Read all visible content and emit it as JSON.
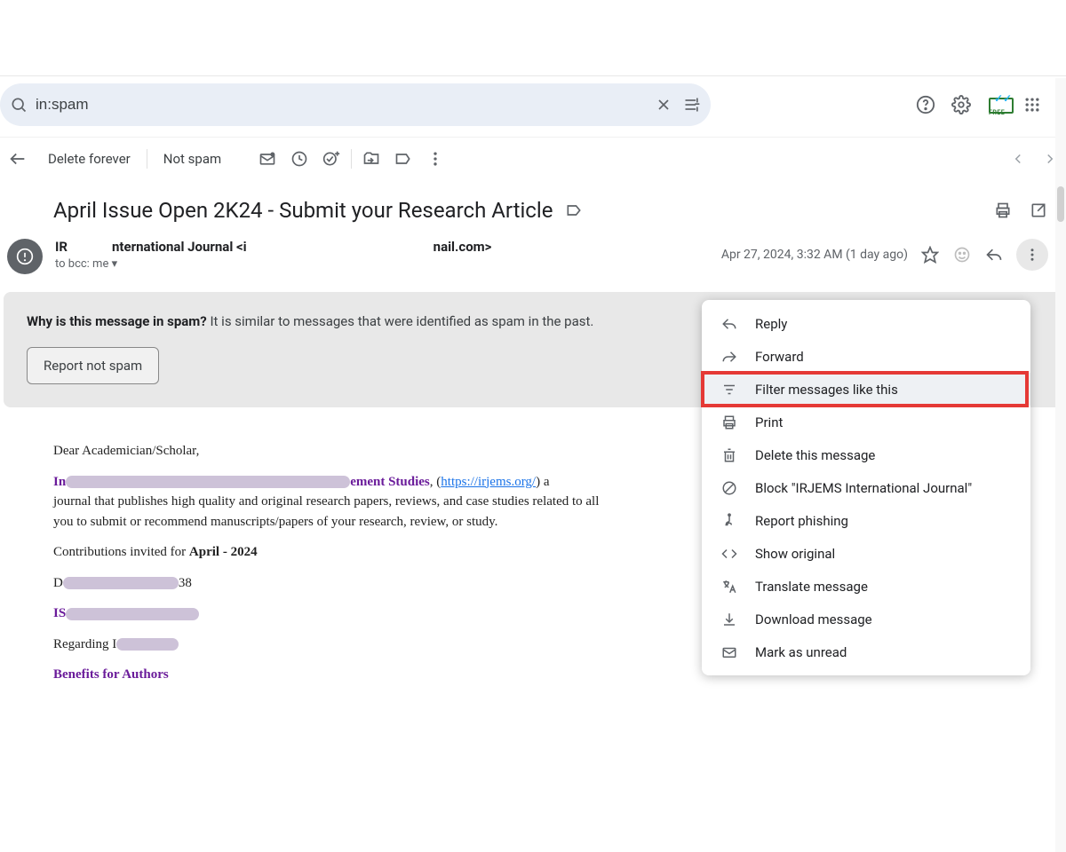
{
  "search": {
    "value": "in:spam"
  },
  "toolbar": {
    "delete_forever": "Delete forever",
    "not_spam": "Not spam"
  },
  "subject": "April Issue Open 2K24 - Submit your Research Article",
  "sender": {
    "prefix": "IR",
    "mid": "nternational Journal <i",
    "suffix": "nail.com>",
    "to_line": "to bcc: me"
  },
  "meta": {
    "timestamp": "Apr 27, 2024, 3:32 AM (1 day ago)"
  },
  "spam": {
    "why_label": "Why is this message in spam?",
    "why_text": " It is similar to messages that were identified as spam in the past.",
    "report_btn": "Report not spam"
  },
  "body": {
    "greeting": "Dear Academician/Scholar,",
    "jname_pre": "In",
    "jname_post": "ement Studies",
    "para_url_label": "https://irjems.org/",
    "para_tail_1": " a",
    "para_line2": "journal that publishes high quality and original research papers, reviews, and case studies related to all",
    "para_line3": "you to submit or recommend manuscripts/papers of your research, review, or study.",
    "contrib_text": "Contributions invited for ",
    "contrib_bold": "April - 2024",
    "d_pre": "D",
    "d_post": "38",
    "issn_pre": "IS",
    "regarding_pre": "Regarding I",
    "benefits": "Benefits for Authors"
  },
  "menu": {
    "reply": "Reply",
    "forward": "Forward",
    "filter": "Filter messages like this",
    "print": "Print",
    "delete": "Delete this message",
    "block": "Block \"IRJEMS International Journal\"",
    "phishing": "Report phishing",
    "show_original": "Show original",
    "translate": "Translate message",
    "download": "Download message",
    "mark_unread": "Mark as unread"
  }
}
